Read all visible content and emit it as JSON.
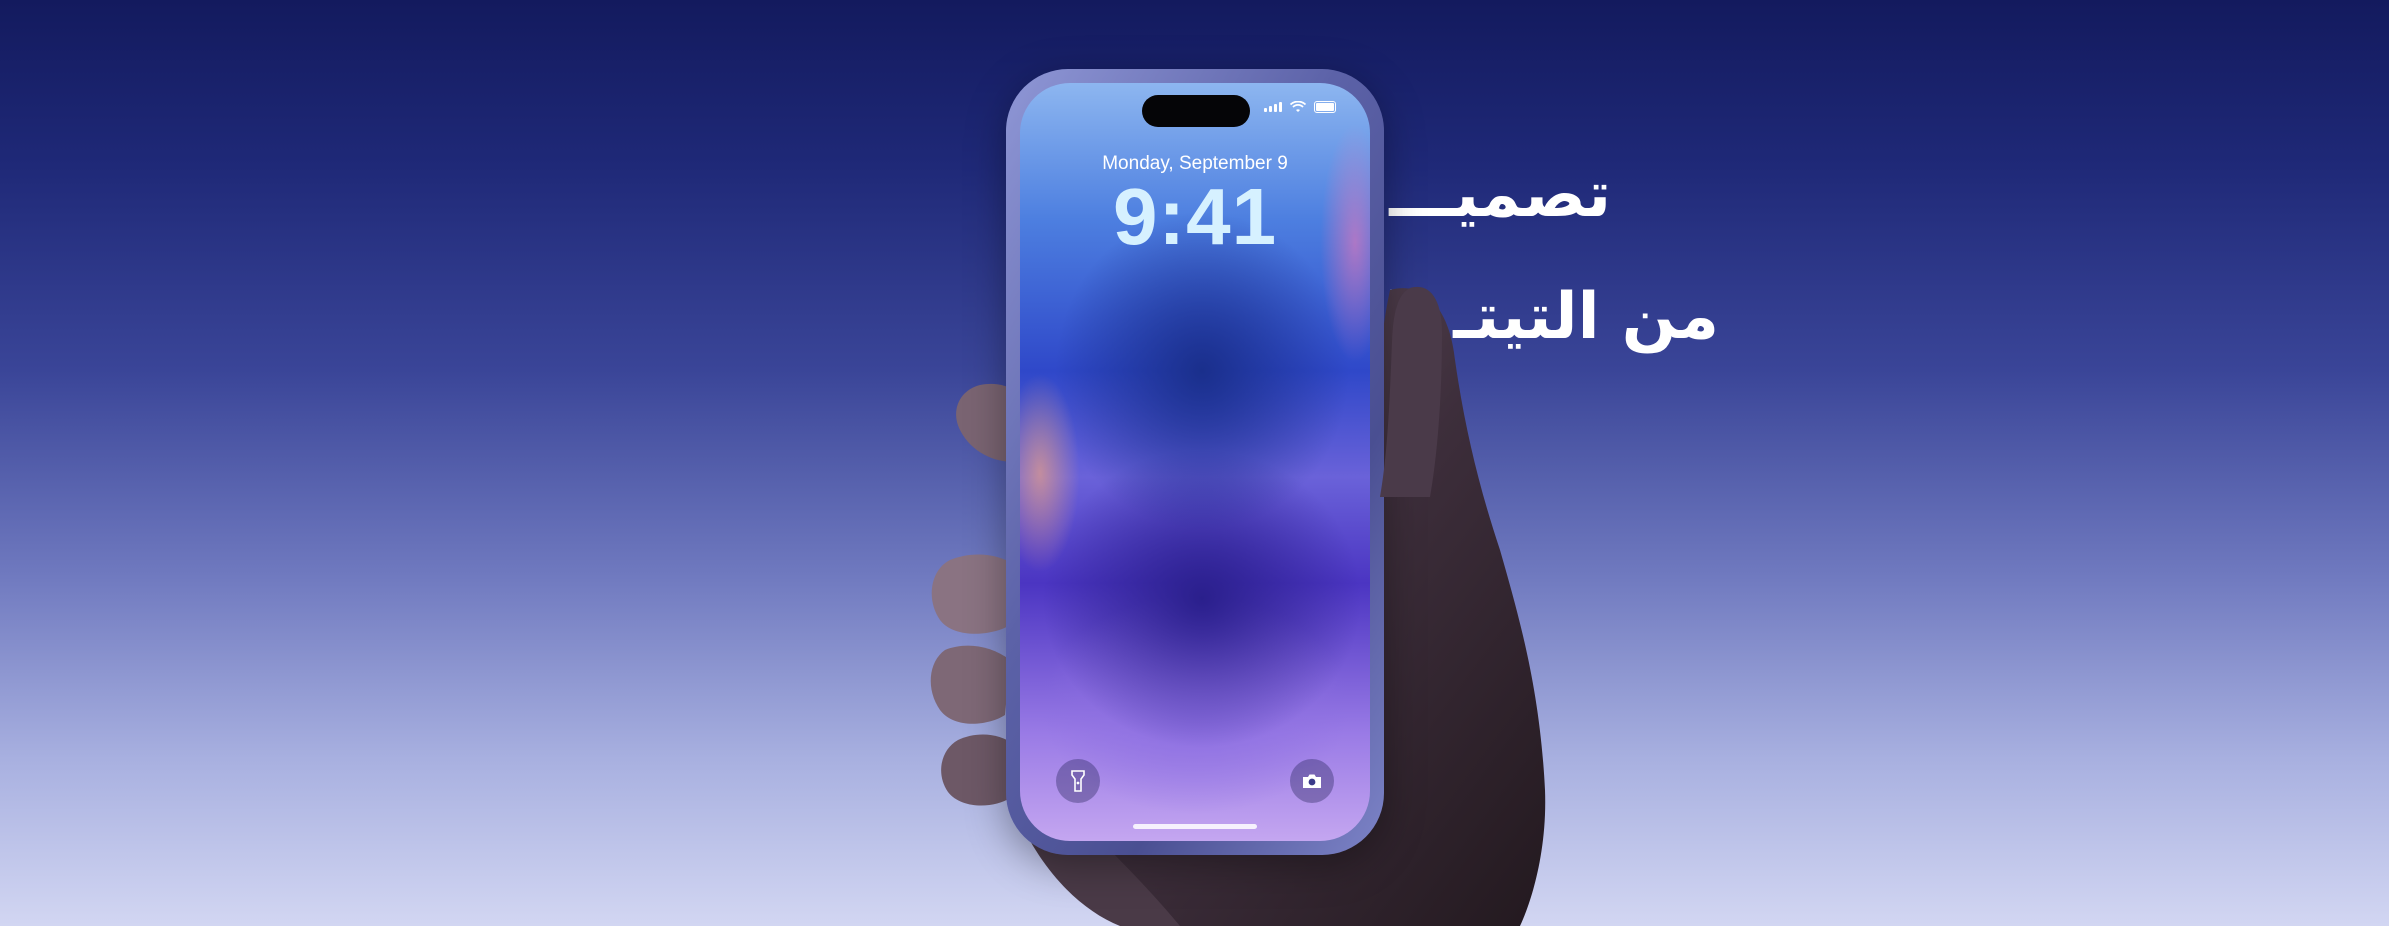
{
  "headline": {
    "line1": "تصميـــ          ـم متين",
    "line2": "من التيتـ          ـانيوم"
  },
  "lockscreen": {
    "date": "Monday, September 9",
    "time": "9:41"
  },
  "icons": {
    "flashlight": "flashlight-icon",
    "camera": "camera-icon",
    "signal": "signal-icon",
    "wifi": "wifi-icon",
    "battery": "battery-icon"
  },
  "colors": {
    "background_top": "#131a5e",
    "background_bottom": "#d2d6f2",
    "time_text": "#d6f1ff"
  }
}
